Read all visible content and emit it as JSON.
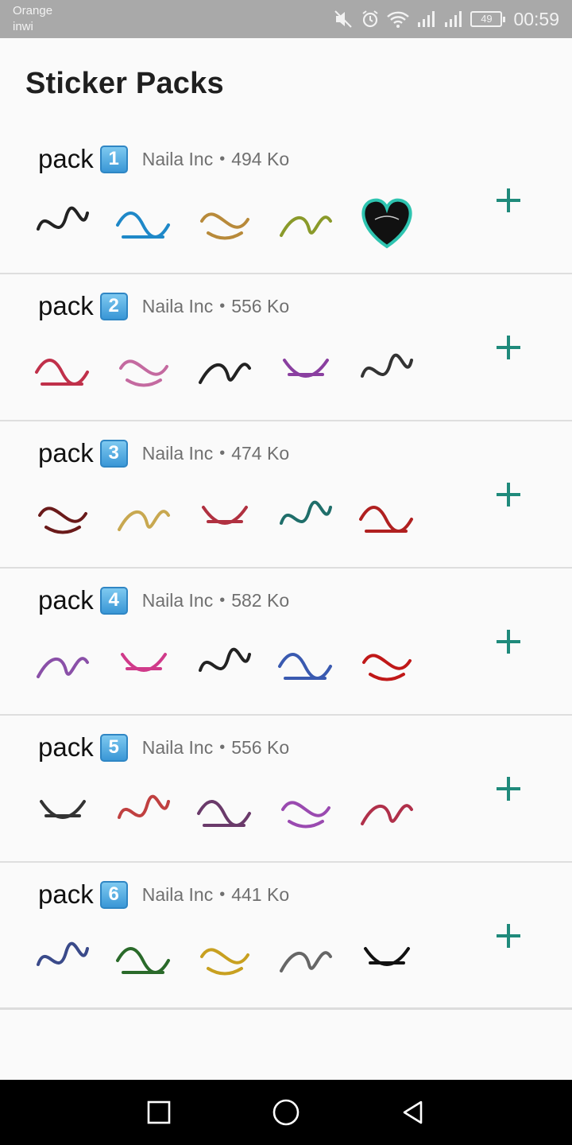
{
  "status_bar": {
    "carrier_1": "Orange",
    "carrier_2": "inwi",
    "battery": "49",
    "time": "00:59",
    "icons": [
      "mute-icon",
      "alarm-icon",
      "wifi-icon",
      "signal-icon",
      "signal-icon",
      "battery-icon"
    ]
  },
  "page": {
    "title": "Sticker Packs"
  },
  "packs": [
    {
      "name": "pack",
      "emoji": "1",
      "publisher": "Naila Inc",
      "separator": "•",
      "size": "494 Ko"
    },
    {
      "name": "pack",
      "emoji": "2",
      "publisher": "Naila Inc",
      "separator": "•",
      "size": "556 Ko"
    },
    {
      "name": "pack",
      "emoji": "3",
      "publisher": "Naila Inc",
      "separator": "•",
      "size": "474 Ko"
    },
    {
      "name": "pack",
      "emoji": "4",
      "publisher": "Naila Inc",
      "separator": "•",
      "size": "582 Ko"
    },
    {
      "name": "pack",
      "emoji": "5",
      "publisher": "Naila Inc",
      "separator": "•",
      "size": "556 Ko"
    },
    {
      "name": "pack",
      "emoji": "6",
      "publisher": "Naila Inc",
      "separator": "•",
      "size": "441 Ko"
    }
  ],
  "colors": {
    "accent": "#1f8a7b",
    "status_bar": "#a9a9a9",
    "nav_bar": "#000000"
  },
  "nav": {
    "icons": [
      "recents-icon",
      "home-icon",
      "back-icon"
    ]
  }
}
